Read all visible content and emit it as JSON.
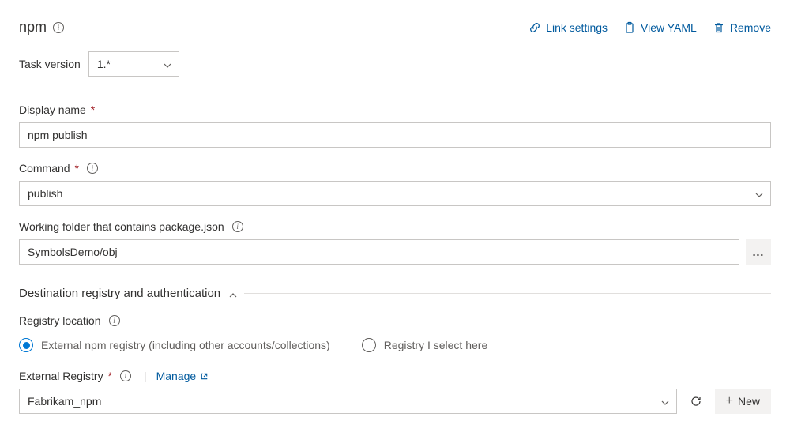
{
  "header": {
    "title": "npm",
    "actions": {
      "link_settings": "Link settings",
      "view_yaml": "View YAML",
      "remove": "Remove"
    }
  },
  "task_version": {
    "label": "Task version",
    "value": "1.*"
  },
  "display_name": {
    "label": "Display name",
    "value": "npm publish"
  },
  "command": {
    "label": "Command",
    "value": "publish"
  },
  "working_folder": {
    "label": "Working folder that contains package.json",
    "value": "SymbolsDemo/obj"
  },
  "section": {
    "title": "Destination registry and authentication"
  },
  "registry_location": {
    "label": "Registry location",
    "options": {
      "external": "External npm registry (including other accounts/collections)",
      "select_here": "Registry I select here"
    },
    "selected": "external"
  },
  "external_registry": {
    "label": "External Registry",
    "manage": "Manage",
    "value": "Fabrikam_npm",
    "new_label": "New"
  },
  "icons": {
    "more": "...",
    "plus": "+"
  }
}
